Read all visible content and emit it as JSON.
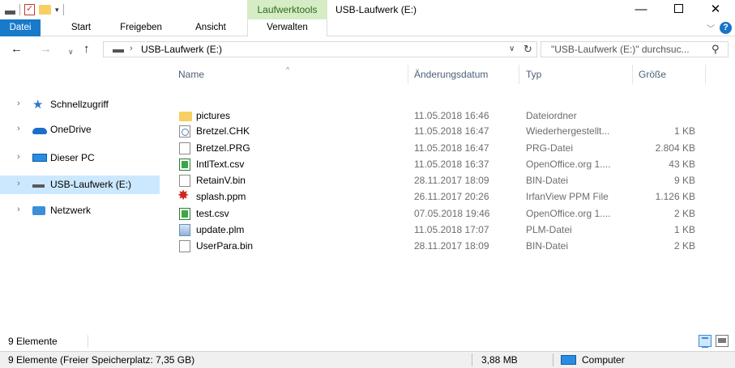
{
  "window": {
    "title": "USB-Laufwerk (E:)",
    "context_tab_header": "Laufwerktools",
    "minimize": "—",
    "close": "✕"
  },
  "ribbon": {
    "tabs": [
      "Datei",
      "Start",
      "Freigeben",
      "Ansicht",
      "Verwalten"
    ],
    "help": "?"
  },
  "address": {
    "path": "USB-Laufwerk (E:)",
    "search_placeholder": "\"USB-Laufwerk (E:)\" durchsuc..."
  },
  "nav": {
    "items": [
      {
        "label": "Schnellzugriff",
        "icon": "star-icon"
      },
      {
        "label": "OneDrive",
        "icon": "cloud-icon"
      },
      {
        "label": "Dieser PC",
        "icon": "pc-icon"
      },
      {
        "label": "USB-Laufwerk (E:)",
        "icon": "drive-icon",
        "selected": true
      },
      {
        "label": "Netzwerk",
        "icon": "network-icon"
      }
    ]
  },
  "columns": {
    "name": "Name",
    "date": "Änderungsdatum",
    "type": "Typ",
    "size": "Größe"
  },
  "files": [
    {
      "name": "pictures",
      "date": "11.05.2018 16:46",
      "type": "Dateiordner",
      "size": "",
      "icon": "folder-icon"
    },
    {
      "name": "Bretzel.CHK",
      "date": "11.05.2018 16:47",
      "type": "Wiederhergestellt...",
      "size": "1 KB",
      "icon": "chk-file-icon"
    },
    {
      "name": "Bretzel.PRG",
      "date": "11.05.2018 16:47",
      "type": "PRG-Datei",
      "size": "2.804 KB",
      "icon": "file-icon"
    },
    {
      "name": "IntlText.csv",
      "date": "11.05.2018 16:37",
      "type": "OpenOffice.org 1....",
      "size": "43 KB",
      "icon": "csv-file-icon"
    },
    {
      "name": "RetainV.bin",
      "date": "28.11.2017 18:09",
      "type": "BIN-Datei",
      "size": "9 KB",
      "icon": "file-icon"
    },
    {
      "name": "splash.ppm",
      "date": "26.11.2017 20:26",
      "type": "IrfanView PPM File",
      "size": "1.126 KB",
      "icon": "ppm-file-icon"
    },
    {
      "name": "test.csv",
      "date": "07.05.2018 19:46",
      "type": "OpenOffice.org 1....",
      "size": "2 KB",
      "icon": "csv-file-icon"
    },
    {
      "name": "update.plm",
      "date": "11.05.2018 17:07",
      "type": "PLM-Datei",
      "size": "1 KB",
      "icon": "plm-file-icon"
    },
    {
      "name": "UserPara.bin",
      "date": "28.11.2017 18:09",
      "type": "BIN-Datei",
      "size": "2 KB",
      "icon": "file-icon"
    }
  ],
  "status": {
    "count": "9 Elemente"
  },
  "info": {
    "free_space": "9 Elemente (Freier Speicherplatz: 7,35 GB)",
    "total_size": "3,88 MB",
    "location": "Computer"
  }
}
